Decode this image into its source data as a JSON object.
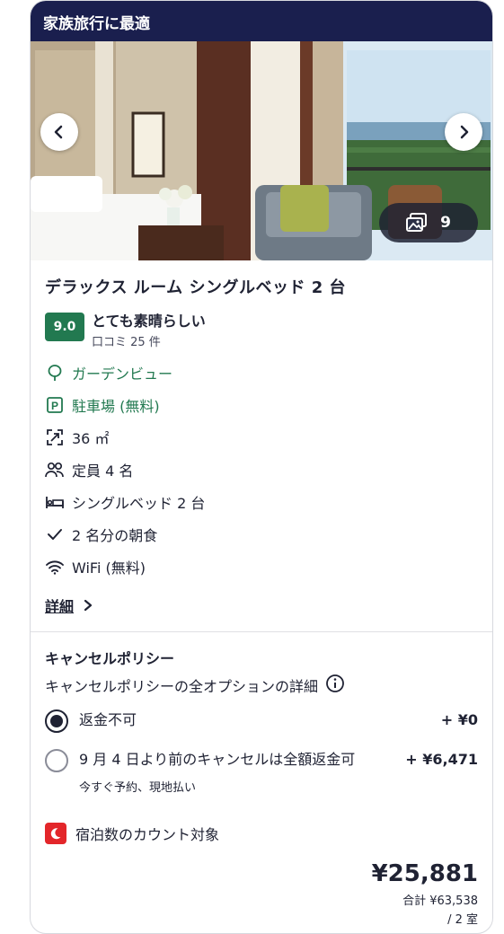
{
  "banner": {
    "text": "家族旅行に最適"
  },
  "gallery": {
    "photo_count": "9"
  },
  "room": {
    "title": "デラックス ルーム シングルベッド 2 台",
    "score": "9.0",
    "rating_label": "とても素晴らしい",
    "review_count": "口コミ 25 件"
  },
  "amenities": [
    {
      "icon": "tree-icon",
      "label": "ガーデンビュー",
      "highlight": true
    },
    {
      "icon": "parking-icon",
      "label": "駐車場 (無料)",
      "highlight": true
    },
    {
      "icon": "expand-area-icon",
      "label": "36 ㎡",
      "highlight": false
    },
    {
      "icon": "people-icon",
      "label": "定員 4 名",
      "highlight": false
    },
    {
      "icon": "bed-icon",
      "label": "シングルベッド 2 台",
      "highlight": false
    },
    {
      "icon": "checkmark-icon",
      "label": "2 名分の朝食",
      "highlight": false
    },
    {
      "icon": "wifi-icon",
      "label": "WiFi (無料)",
      "highlight": false
    }
  ],
  "details_link": "詳細",
  "policy": {
    "title": "キャンセルポリシー",
    "subtitle": "キャンセルポリシーの全オプションの詳細",
    "options": [
      {
        "label": "返金不可",
        "price": "+ ¥0",
        "selected": true,
        "note": ""
      },
      {
        "label": "9 月 4 日より前のキャンセルは全額返金可",
        "price": "+ ¥6,471",
        "selected": false,
        "note": "今すぐ予約、現地払い"
      }
    ]
  },
  "night_count": {
    "label": "宿泊数のカウント対象"
  },
  "pricing": {
    "price": "¥25,881",
    "total": "合計 ¥63,538",
    "per_rooms": "/ 2 室"
  },
  "colors": {
    "banner_bg": "#1a1f4e",
    "accent_green": "#227950",
    "badge_red": "#e3262a",
    "text_primary": "#1f2233"
  }
}
